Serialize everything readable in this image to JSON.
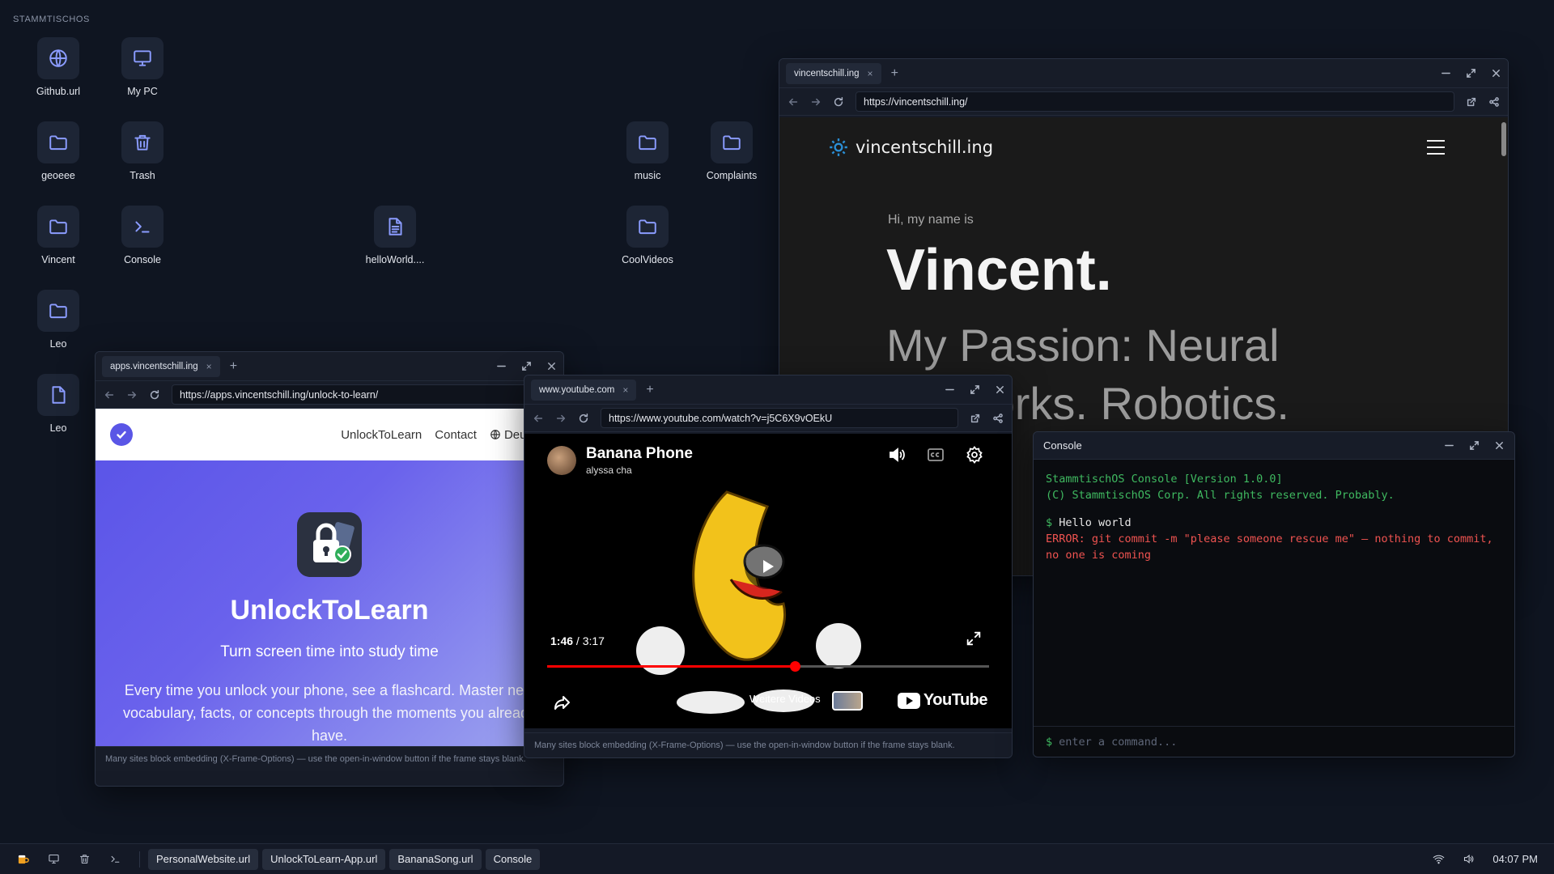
{
  "desktop": {
    "label": "STAMMTISCHOS",
    "icons": [
      {
        "label": "Github.url",
        "icon": "globe-icon"
      },
      {
        "label": "My PC",
        "icon": "monitor-icon"
      },
      {
        "label": "geoeee",
        "icon": "folder-icon"
      },
      {
        "label": "Trash",
        "icon": "trash-icon"
      },
      {
        "label": "Vincent",
        "icon": "folder-icon"
      },
      {
        "label": "Console",
        "icon": "terminal-icon"
      },
      {
        "label": "Leo",
        "icon": "folder-icon"
      },
      {
        "label": "Leo",
        "icon": "file-icon"
      },
      {
        "label": "helloWorld....",
        "icon": "document-icon"
      },
      {
        "label": "music",
        "icon": "folder-icon"
      },
      {
        "label": "Complaints",
        "icon": "folder-icon"
      },
      {
        "label": "CoolVideos",
        "icon": "folder-icon"
      }
    ]
  },
  "personal_site": {
    "tab": "vincentschill.ing",
    "url": "https://vincentschill.ing/",
    "logo": "vincentschill.ing",
    "greeting": "Hi, my name is",
    "name": "Vincent.",
    "passion": "My Passion: Neural",
    "passion2": "Networks. Robotics."
  },
  "unlock_app": {
    "tab": "apps.vincentschill.ing",
    "url": "https://apps.vincentschill.ing/unlock-to-learn/",
    "nav": [
      "UnlockToLearn",
      "Contact",
      "Deutsch"
    ],
    "title": "UnlockToLearn",
    "subtitle": "Turn screen time into study time",
    "description": "Every time you unlock your phone, see a flashcard. Master new vocabulary, facts, or concepts through the moments you already have.",
    "note": "Many sites block embedding (X-Frame-Options) — use the open-in-window button if the frame stays blank."
  },
  "youtube": {
    "tab": "www.youtube.com",
    "url": "https://www.youtube.com/watch?v=j5C6X9vOEkU",
    "title": "Banana Phone",
    "channel": "alyssa cha",
    "current_time": "1:46",
    "separator": "/",
    "duration": "3:17",
    "progress": 0.56,
    "more_videos": "Weitere Videos",
    "logo": "YouTube",
    "note": "Many sites block embedding (X-Frame-Options) — use the open-in-window button if the frame stays blank."
  },
  "console": {
    "title": "Console",
    "lines": {
      "header1": "StammtischOS Console [Version 1.0.0]",
      "header2": "(C) StammtischOS Corp. All rights reserved. Probably.",
      "prompt": "$",
      "command": "Hello world",
      "error": "ERROR: git commit -m \"please someone rescue me\" — nothing to commit, no one is coming"
    },
    "input_placeholder": "enter a command..."
  },
  "taskbar": {
    "buttons": [
      "PersonalWebsite.url",
      "UnlockToLearn-App.url",
      "BananaSong.url",
      "Console"
    ],
    "clock": "04:07 PM"
  },
  "colors": {
    "accent": "#8b9cff",
    "desktop_bg": "#0f1521",
    "console_green": "#3fb960",
    "console_red": "#ef5350",
    "youtube_red": "#ff0000",
    "unlock_purple": "#5b55e8"
  }
}
